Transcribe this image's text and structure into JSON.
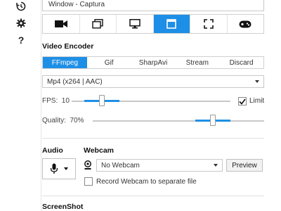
{
  "rail": {
    "icons": [
      "history-icon",
      "gear-icon",
      "help-icon"
    ]
  },
  "capture": {
    "window_label": "Window - Captura",
    "modes": [
      {
        "icon": "camera-icon",
        "active": false
      },
      {
        "icon": "window-stack-icon",
        "active": false
      },
      {
        "icon": "monitor-icon",
        "active": false
      },
      {
        "icon": "region-window-icon",
        "active": true
      },
      {
        "icon": "fullscreen-corners-icon",
        "active": false
      },
      {
        "icon": "gamepad-icon",
        "active": false
      }
    ]
  },
  "video_encoder": {
    "title": "Video Encoder",
    "tabs": [
      "FFmpeg",
      "Gif",
      "SharpAvi",
      "Stream",
      "Discard"
    ],
    "active_tab": "FFmpeg",
    "codec": "Mp4 (x264 | AAC)",
    "fps_label": "FPS:",
    "fps_value": "10",
    "fps_fraction": 0.19,
    "limit_label": "Limit",
    "limit_checked": true,
    "quality_label": "Quality:",
    "quality_value": "70%",
    "quality_fraction": 0.7
  },
  "audio": {
    "title": "Audio",
    "mic_icon": "microphone-icon"
  },
  "webcam": {
    "title": "Webcam",
    "icon": "webcam-icon",
    "selected": "No Webcam",
    "preview_label": "Preview",
    "separate_file_label": "Record Webcam to separate file",
    "separate_file_checked": false
  },
  "screenshot": {
    "title": "ScreenShot"
  },
  "colors": {
    "accent": "#1e8fe6"
  }
}
